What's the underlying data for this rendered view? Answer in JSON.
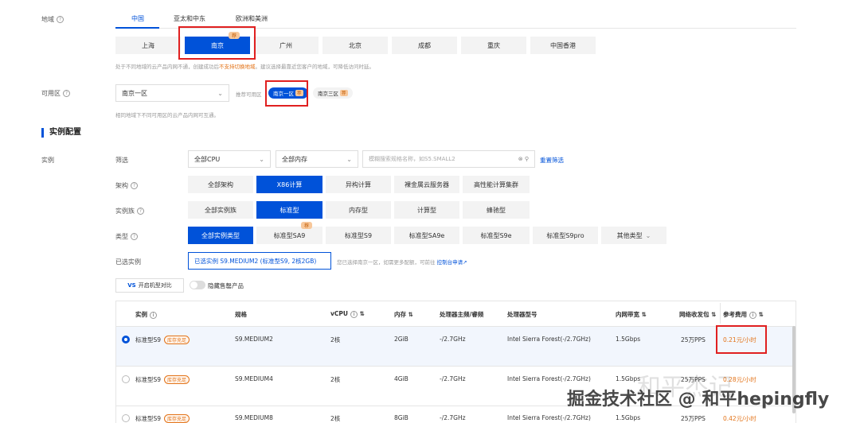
{
  "region": {
    "label": "地域",
    "tabs": [
      "中国",
      "亚太和中东",
      "欧洲和美洲"
    ],
    "cities": [
      "上海",
      "南京",
      "广州",
      "北京",
      "成都",
      "重庆",
      "中国香港"
    ],
    "selected_city_badge": "荐",
    "hint_prefix": "处于不同地域的云产品内网不通，创建成功后",
    "hint_warn": "不支持切换地域",
    "hint_suffix": "。建议选择最靠近您客户的地域，可降低访问时延。"
  },
  "zone": {
    "label": "可用区",
    "select_value": "南京一区",
    "recommend_label": "推荐可用区",
    "pill_selected": "南京一区",
    "pill_other": "南京三区",
    "pill_badge": "荐",
    "hint": "相同地域下不同可用区的云产品内网可互通。"
  },
  "instance_config": {
    "title": "实例配置",
    "instance_label": "实例",
    "filter_label": "筛选",
    "cpu_select": "全部CPU",
    "mem_select": "全部内存",
    "search_placeholder": "模糊搜索规格名称，如S5.SMALL2",
    "reset_filter": "重置筛选",
    "arch_label": "架构",
    "arch_options": [
      "全部架构",
      "X86计算",
      "异构计算",
      "裸金属云服务器",
      "高性能计算集群"
    ],
    "family_label": "实例族",
    "family_options": [
      "全部实例族",
      "标准型",
      "内存型",
      "计算型",
      "蜂驰型"
    ],
    "type_label": "类型",
    "type_options": [
      "全部实例类型",
      "标准型SA9",
      "标准型S9",
      "标准型SA9e",
      "标准型S9e",
      "标准型S9pro",
      "其他类型"
    ],
    "type_badge": "荐",
    "selected_label": "已选实例",
    "selected_value": "已选实例  S9.MEDIUM2 (标准型S9, 2核2GB)",
    "selected_hint": "您已选择南京一区，如需更多配额，可前往",
    "selected_link": "控制台申请",
    "compare_button": "开启机型对比",
    "hide_soldout": "隐藏售罄产品"
  },
  "table": {
    "headers": [
      "实例",
      "规格",
      "vCPU",
      "内存",
      "处理器主频/睿频",
      "处理器型号",
      "内网带宽",
      "网络收发包",
      "参考费用"
    ],
    "rows": [
      {
        "name": "标准型S9",
        "tag": "库存充足",
        "spec": "S9.MEDIUM2",
        "vcpu": "2核",
        "mem": "2GiB",
        "freq": "-/2.7GHz",
        "cpu": "Intel Sierra Forest(-/2.7GHz)",
        "bw": "1.5Gbps",
        "pps": "25万PPS",
        "price": "0.21元/小时"
      },
      {
        "name": "标准型S9",
        "tag": "库存充足",
        "spec": "S9.MEDIUM4",
        "vcpu": "2核",
        "mem": "4GiB",
        "freq": "-/2.7GHz",
        "cpu": "Intel Sierra Forest(-/2.7GHz)",
        "bw": "1.5Gbps",
        "pps": "25万PPS",
        "price": "0.28元/小时"
      },
      {
        "name": "标准型S9",
        "tag": "库存充足",
        "spec": "S9.MEDIUM8",
        "vcpu": "2核",
        "mem": "8GiB",
        "freq": "-/2.7GHz",
        "cpu": "Intel Sierra Forest(-/2.7GHz)",
        "bw": "1.5Gbps",
        "pps": "25万PPS",
        "price": "0.42元/小时"
      }
    ]
  },
  "watermark": {
    "text": "掘金技术社区 @ 和平hepingfly",
    "faint": "和平杰记"
  },
  "colors": {
    "accent": "#0052d9",
    "warn": "#e37318",
    "highlight": "#e02020"
  }
}
